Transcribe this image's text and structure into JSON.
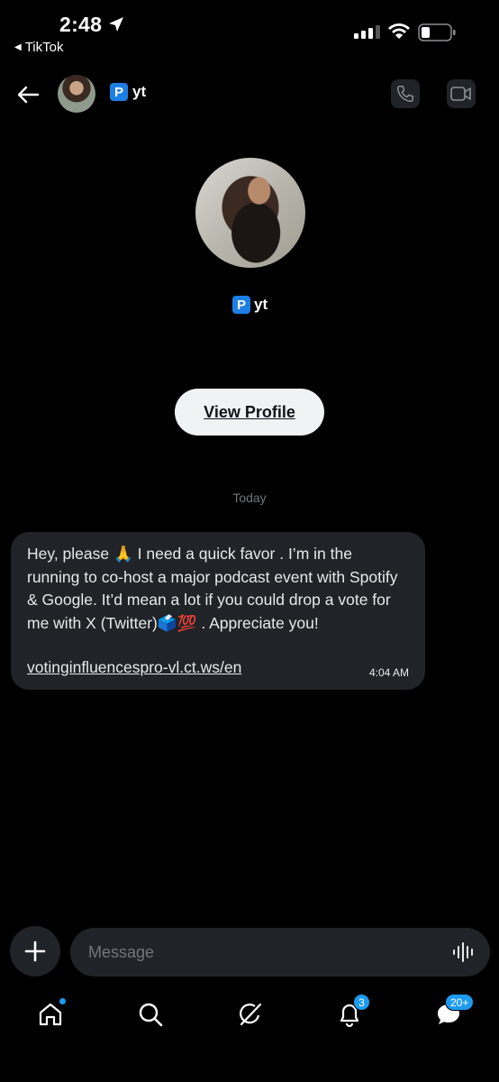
{
  "status_bar": {
    "time": "2:48",
    "back_app": "TikTok"
  },
  "header": {
    "name": "yt",
    "badge_letter": "P"
  },
  "profile": {
    "name": "yt",
    "badge_letter": "P",
    "view_profile_label": "View Profile"
  },
  "conversation": {
    "date_separator": "Today",
    "messages": [
      {
        "text": "Hey, please 🙏 I need a quick favor . I’m in the running to co-host a major podcast event with Spotify & Google. It’d mean a lot if you could drop a vote for me with X (Twitter)🗳️💯 . Appreciate you!",
        "link": "votinginfluencespro-vl.ct.ws/en",
        "time": "4:04 AM"
      }
    ]
  },
  "composer": {
    "placeholder": "Message",
    "value": ""
  },
  "bottom_nav": {
    "notifications_count": "3",
    "messages_count": "20+"
  },
  "colors": {
    "background": "#000000",
    "bubble": "#202327",
    "accent": "#1d9bf0",
    "muted_text": "#71767b"
  },
  "icons": [
    "location-arrow-icon",
    "signal-icon",
    "wifi-icon",
    "battery-icon",
    "back-arrow-icon",
    "phone-icon",
    "video-camera-icon",
    "plus-icon",
    "voice-waveform-icon",
    "home-icon",
    "search-icon",
    "grok-icon",
    "bell-icon",
    "messages-icon"
  ]
}
